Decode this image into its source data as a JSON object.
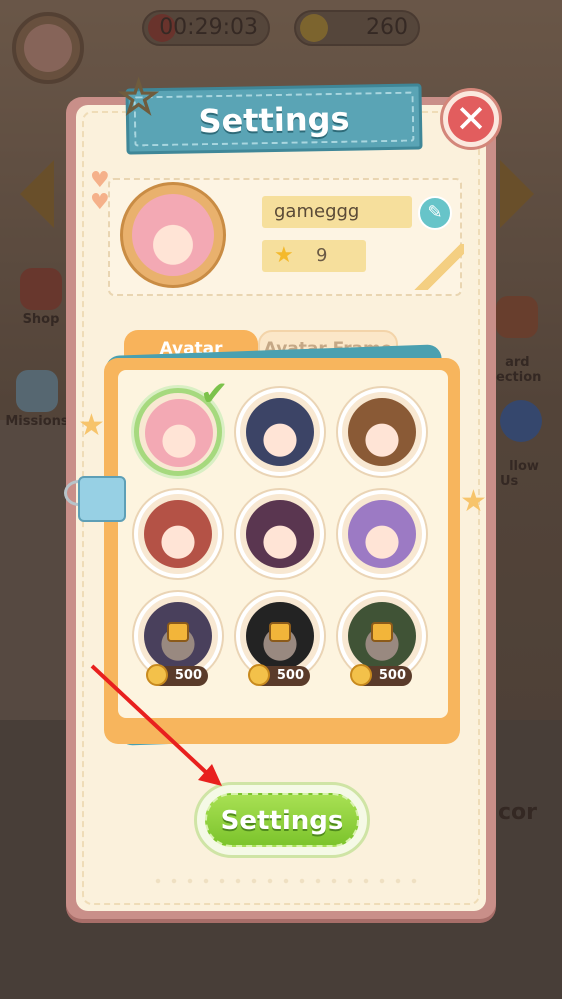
{
  "hud": {
    "timer": "00:29:03",
    "coins": "260"
  },
  "side_buttons": {
    "shop": "Shop",
    "missions": "Missions",
    "card_collection": "ard\nection",
    "follow_us": "llow\nUs",
    "decor": "cor"
  },
  "dialog": {
    "title": "Settings",
    "close_icon": "close-icon",
    "profile": {
      "username": "gameggg",
      "level": "9"
    },
    "tabs": [
      {
        "label": "Avatar",
        "active": true
      },
      {
        "label": "Avatar Frame",
        "active": false
      }
    ],
    "avatars": [
      {
        "name": "pink-hair-girl",
        "selected": true,
        "locked": false,
        "color": "#f3a9b4"
      },
      {
        "name": "dark-hair-boy",
        "selected": false,
        "locked": false,
        "color": "#3c4466"
      },
      {
        "name": "brown-hair-boy",
        "selected": false,
        "locked": false,
        "color": "#8a5a36"
      },
      {
        "name": "red-hat-girl",
        "selected": false,
        "locked": false,
        "color": "#b45246"
      },
      {
        "name": "punk-girl",
        "selected": false,
        "locked": false,
        "color": "#5a3650"
      },
      {
        "name": "purple-cap-girl",
        "selected": false,
        "locked": false,
        "color": "#9c7ac4"
      },
      {
        "name": "purple-braid",
        "selected": false,
        "locked": true,
        "price": "500",
        "color": "#7a6a9a"
      },
      {
        "name": "glasses-girl",
        "selected": false,
        "locked": true,
        "price": "500",
        "color": "#3a3a3a"
      },
      {
        "name": "green-hair-maid",
        "selected": false,
        "locked": true,
        "price": "500",
        "color": "#6a8a5a"
      }
    ],
    "settings_button": "Settings"
  },
  "colors": {
    "title_banner": "#5aa4b5",
    "close": "#e25d5e",
    "tab_active": "#f8b35b",
    "settings_button": "#8fd03c",
    "annotation_arrow": "#e8201e"
  }
}
